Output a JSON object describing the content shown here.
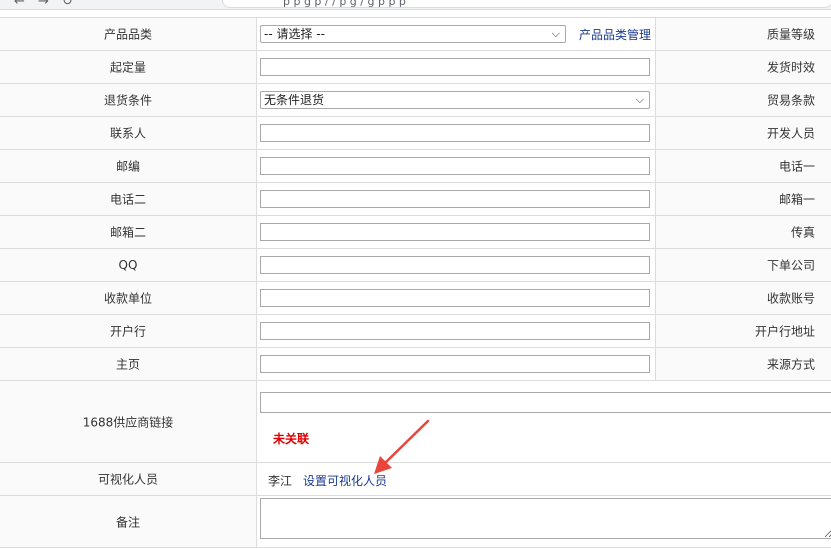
{
  "browser": {
    "url_fragment": "p   p   g  p   /    /  p   g   /    g  p   p  p"
  },
  "form": {
    "category": {
      "label": "产品品类",
      "select_value": "-- 请选择 --",
      "manage_link": "产品品类管理",
      "right_label": "质量等级"
    },
    "min_order": {
      "label": "起定量",
      "value": "",
      "right_label": "发货时效"
    },
    "return_policy": {
      "label": "退货条件",
      "select_value": "无条件退货",
      "right_label": "贸易条款"
    },
    "contact": {
      "label": "联系人",
      "value": "",
      "right_label": "开发人员"
    },
    "postcode": {
      "label": "邮编",
      "value": "",
      "right_label": "电话一"
    },
    "phone2": {
      "label": "电话二",
      "value": "",
      "right_label": "邮箱一"
    },
    "email2": {
      "label": "邮箱二",
      "value": "",
      "right_label": "传真"
    },
    "qq": {
      "label": "QQ",
      "value": "",
      "right_label": "下单公司"
    },
    "payee": {
      "label": "收款单位",
      "value": "",
      "right_label": "收款账号"
    },
    "bank": {
      "label": "开户行",
      "value": "",
      "right_label": "开户行地址"
    },
    "homepage": {
      "label": "主页",
      "value": "",
      "right_label": "来源方式"
    },
    "link_1688": {
      "label": "1688供应商链接",
      "value": "",
      "status": "未关联"
    },
    "visual_staff": {
      "label": "可视化人员",
      "name": "李江",
      "set_link": "设置可视化人员"
    },
    "remark": {
      "label": "备注",
      "value": ""
    }
  },
  "colors": {
    "link": "#1a3a8c",
    "status_red": "#e00000",
    "annotation_arrow": "#e8453c"
  }
}
